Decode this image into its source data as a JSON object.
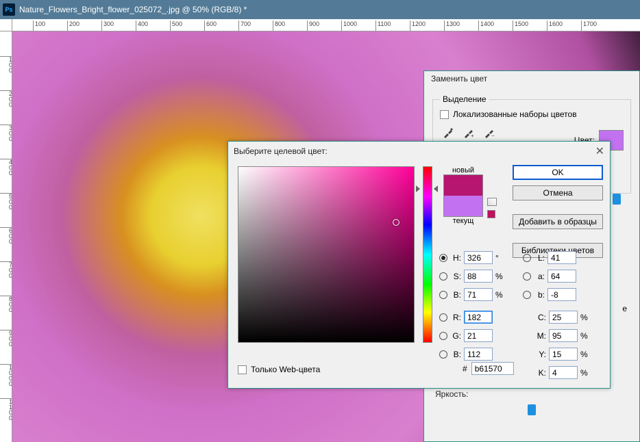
{
  "window": {
    "title": "Nature_Flowers_Bright_flower_025072_.jpg @ 50% (RGB/8) *",
    "ps": "Ps"
  },
  "ruler_h": [
    "100",
    "200",
    "300",
    "400",
    "500",
    "600",
    "700",
    "800",
    "900",
    "1000",
    "1100",
    "1200",
    "1300",
    "1400",
    "1500",
    "1600",
    "1700"
  ],
  "ruler_v": [
    "100",
    "200",
    "300",
    "400",
    "500",
    "600",
    "700",
    "800",
    "900",
    "1000",
    "1100"
  ],
  "replace": {
    "title": "Заменить цвет",
    "fieldset": "Выделение",
    "localized": "Локализованные наборы цветов",
    "color_label": "Цвет:",
    "brightness": "Яркость:",
    "letter_e": "e"
  },
  "picker": {
    "title": "Выберите целевой цвет:",
    "new": "новый",
    "current": "текущ",
    "ok": "OK",
    "cancel": "Отмена",
    "add": "Добавить в образцы",
    "libs": "Библиотеки цветов",
    "webonly": "Только Web-цвета",
    "H": {
      "label": "H:",
      "val": "326",
      "unit": "°"
    },
    "S": {
      "label": "S:",
      "val": "88",
      "unit": "%"
    },
    "B": {
      "label": "B:",
      "val": "71",
      "unit": "%"
    },
    "R": {
      "label": "R:",
      "val": "182"
    },
    "G": {
      "label": "G:",
      "val": "21"
    },
    "Bb": {
      "label": "B:",
      "val": "112"
    },
    "L": {
      "label": "L:",
      "val": "41"
    },
    "a": {
      "label": "a:",
      "val": "64"
    },
    "b2": {
      "label": "b:",
      "val": "-8"
    },
    "C": {
      "label": "C:",
      "val": "25",
      "unit": "%"
    },
    "M": {
      "label": "M:",
      "val": "95",
      "unit": "%"
    },
    "Y": {
      "label": "Y:",
      "val": "15",
      "unit": "%"
    },
    "K": {
      "label": "K:",
      "val": "4",
      "unit": "%"
    },
    "hexlabel": "#",
    "hex": "b61570"
  }
}
